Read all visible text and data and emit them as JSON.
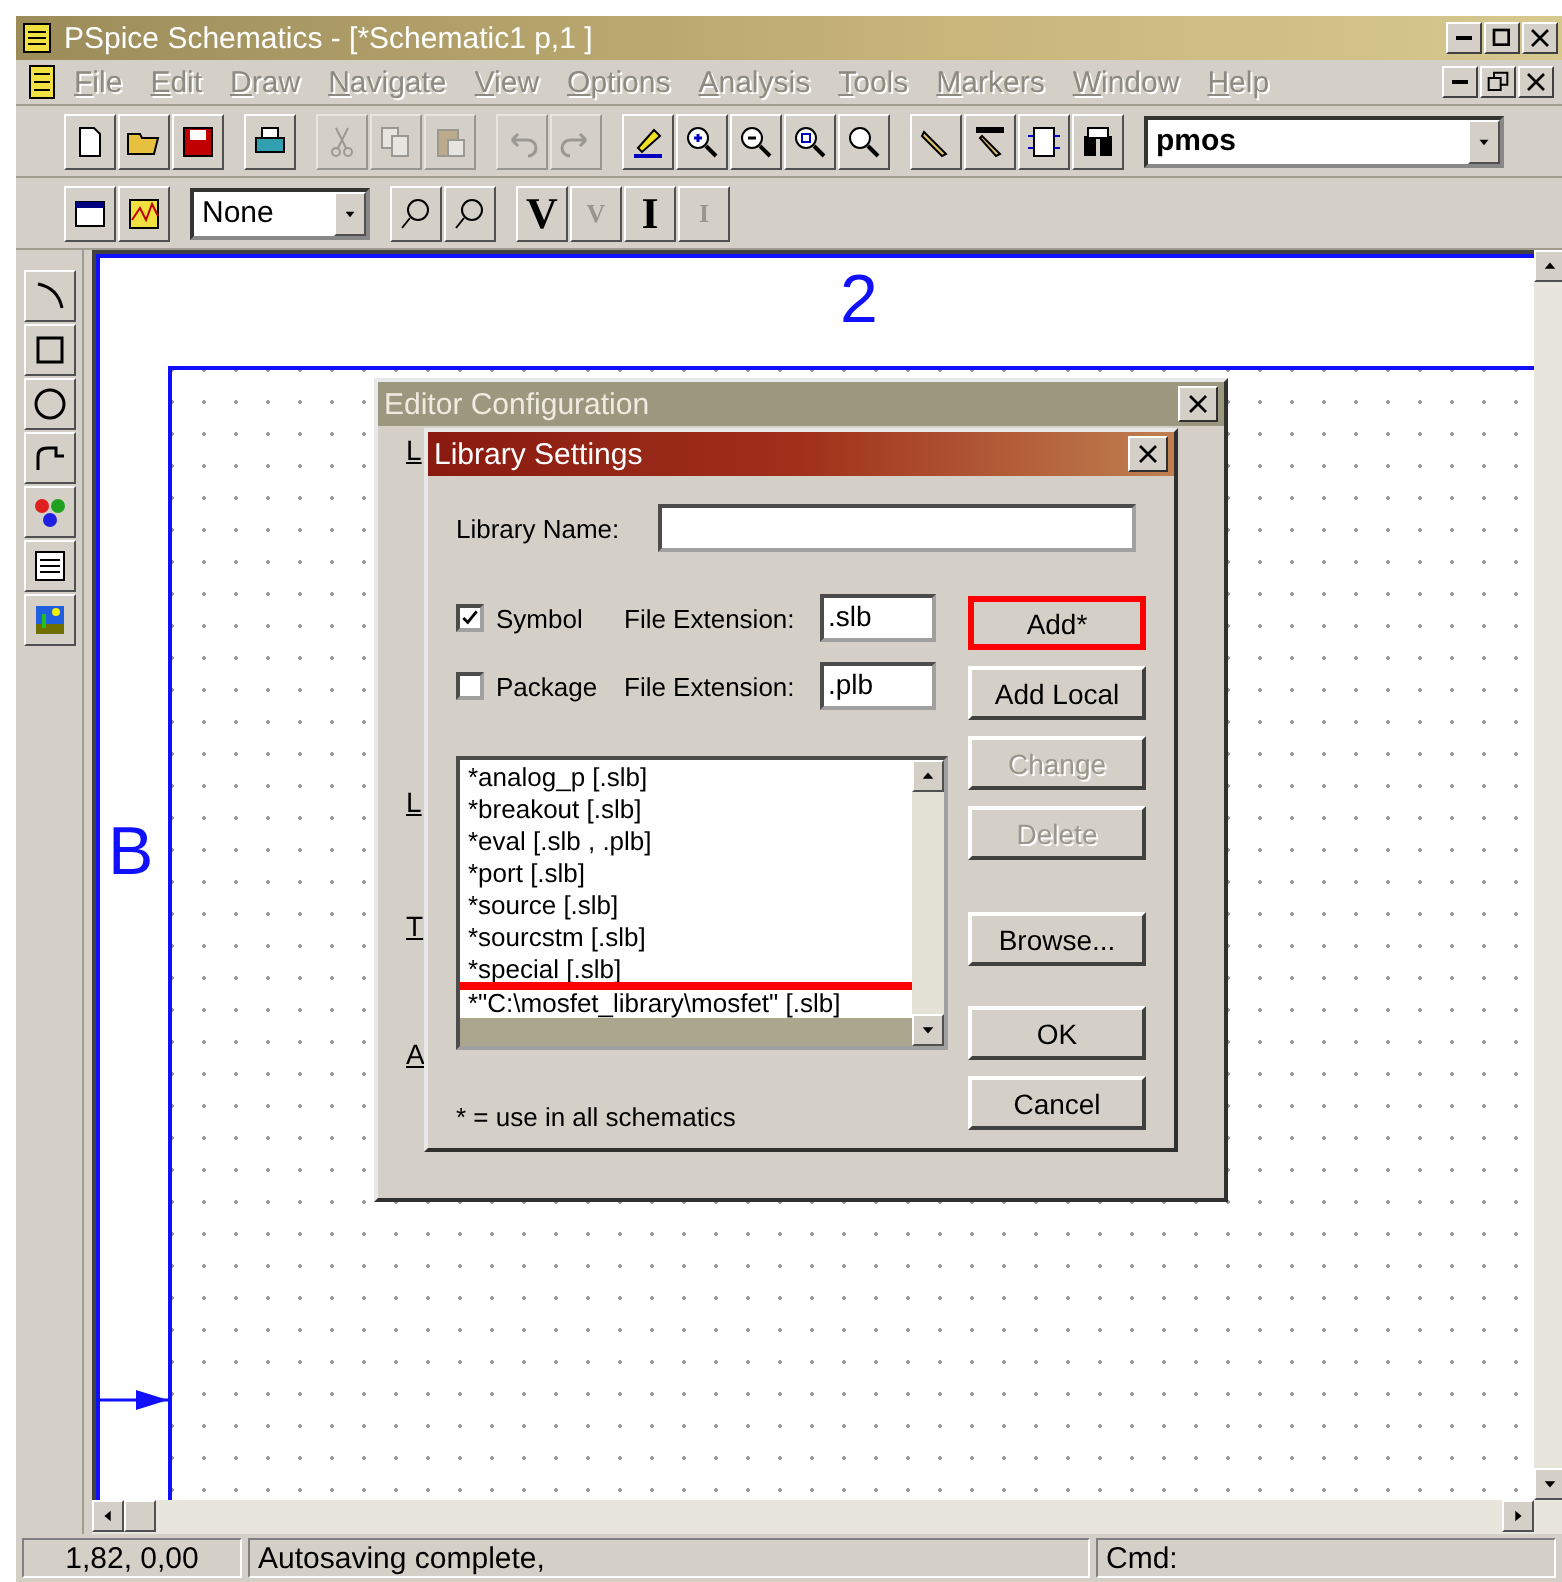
{
  "window": {
    "title": "PSpice Schematics - [*Schematic1  p,1   ]"
  },
  "menu": [
    {
      "label": "File",
      "disabled": true
    },
    {
      "label": "Edit",
      "disabled": true
    },
    {
      "label": "Draw",
      "disabled": true
    },
    {
      "label": "Navigate",
      "disabled": true
    },
    {
      "label": "View",
      "disabled": true
    },
    {
      "label": "Options",
      "disabled": true
    },
    {
      "label": "Analysis",
      "disabled": true
    },
    {
      "label": "Tools",
      "disabled": true
    },
    {
      "label": "Markers",
      "disabled": true
    },
    {
      "label": "Window",
      "disabled": true
    },
    {
      "label": "Help",
      "disabled": true
    }
  ],
  "toolbar": [
    {
      "kind": "new",
      "disabled": false
    },
    {
      "kind": "open",
      "disabled": false
    },
    {
      "kind": "save",
      "disabled": false
    },
    {
      "kind": "sep"
    },
    {
      "kind": "print",
      "disabled": false
    },
    {
      "kind": "sep"
    },
    {
      "kind": "cut",
      "disabled": true
    },
    {
      "kind": "copy",
      "disabled": true
    },
    {
      "kind": "paste",
      "disabled": true
    },
    {
      "kind": "sep"
    },
    {
      "kind": "undo",
      "disabled": true
    },
    {
      "kind": "redo",
      "disabled": true
    },
    {
      "kind": "sep"
    },
    {
      "kind": "highlight",
      "disabled": false
    },
    {
      "kind": "zoomin",
      "disabled": false
    },
    {
      "kind": "zoomout",
      "disabled": false
    },
    {
      "kind": "zoomarea",
      "disabled": false
    },
    {
      "kind": "zoomfit",
      "disabled": false
    },
    {
      "kind": "sep"
    },
    {
      "kind": "wire",
      "disabled": false
    },
    {
      "kind": "bus",
      "disabled": false
    },
    {
      "kind": "block",
      "disabled": false
    },
    {
      "kind": "parts",
      "disabled": false
    }
  ],
  "part_field": {
    "value": "pmos"
  },
  "marker_dropdown": {
    "value": "None"
  },
  "probe_tools": [
    {
      "label": "V",
      "disabled": false
    },
    {
      "label": "V",
      "disabled": true
    },
    {
      "label": "I",
      "disabled": false
    },
    {
      "label": "I",
      "disabled": true
    }
  ],
  "canvas": {
    "column_label": "2",
    "row_label": "B"
  },
  "editor_configuration": {
    "title": "Editor Configuration",
    "cut_labels": [
      "L",
      "L",
      "T",
      "A"
    ]
  },
  "library_settings": {
    "title": "Library Settings",
    "library_name_label": "Library Name:",
    "rows": [
      {
        "label": "Symbol",
        "checked": true,
        "extension_label": "File Extension:",
        "extension": ".slb"
      },
      {
        "label": "Package",
        "checked": false,
        "extension_label": "File Extension:",
        "extension": ".plb"
      }
    ],
    "libraries": [
      {
        "text": "*analog_p [.slb]",
        "highlighted": false
      },
      {
        "text": "*breakout [.slb]",
        "highlighted": false
      },
      {
        "text": "*eval [.slb , .plb]",
        "highlighted": false
      },
      {
        "text": "*port [.slb]",
        "highlighted": false
      },
      {
        "text": "*source [.slb]",
        "highlighted": false
      },
      {
        "text": "*sourcstm [.slb]",
        "highlighted": false
      },
      {
        "text": "*special [.slb]",
        "highlighted": false
      },
      {
        "text": "*\"C:\\mosfet_library\\mosfet\" [.slb]",
        "highlighted": true
      }
    ],
    "note": "* = use in all schematics",
    "buttons": [
      {
        "label": "Add*",
        "disabled": false,
        "highlighted": true
      },
      {
        "label": "Add Local",
        "disabled": false,
        "highlighted": false
      },
      {
        "label": "Change",
        "disabled": true,
        "highlighted": false
      },
      {
        "label": "Delete",
        "disabled": true,
        "highlighted": false
      },
      {
        "label": "Browse...",
        "disabled": false,
        "highlighted": false
      },
      {
        "label": "OK",
        "disabled": false,
        "highlighted": false
      },
      {
        "label": "Cancel",
        "disabled": false,
        "highlighted": false
      }
    ]
  },
  "status_bar": [
    "1,82,  0,00",
    "Autosaving complete,",
    "Cmd:"
  ]
}
